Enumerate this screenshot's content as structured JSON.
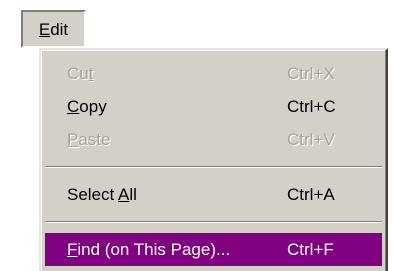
{
  "menubar": {
    "edit_label_mnemonic": "E",
    "edit_label_rest": "dit"
  },
  "menu": {
    "items": [
      {
        "label_pre": "Cu",
        "mnemonic": "t",
        "label_post": "",
        "shortcut": "Ctrl+X",
        "state": "disabled"
      },
      {
        "label_pre": "",
        "mnemonic": "C",
        "label_post": "opy",
        "shortcut": "Ctrl+C",
        "state": "enabled"
      },
      {
        "label_pre": "",
        "mnemonic": "P",
        "label_post": "aste",
        "shortcut": "Ctrl+V",
        "state": "disabled"
      },
      {
        "label_pre": "Select ",
        "mnemonic": "A",
        "label_post": "ll",
        "shortcut": "Ctrl+A",
        "state": "enabled"
      },
      {
        "label_pre": "",
        "mnemonic": "F",
        "label_post": "ind (on This Page)...",
        "shortcut": "Ctrl+F",
        "state": "highlighted"
      }
    ]
  },
  "colors": {
    "menu_background": "#d4d0c8",
    "highlight": "#800080",
    "disabled_text": "#a6a39c"
  }
}
